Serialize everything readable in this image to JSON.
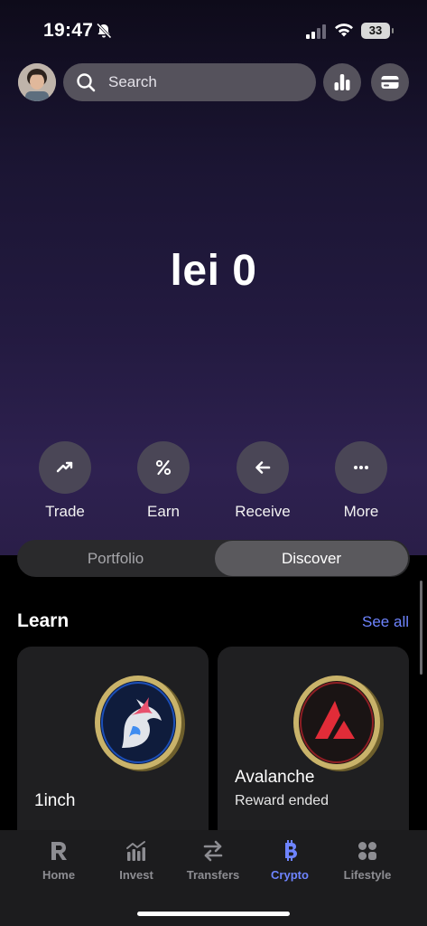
{
  "status_bar": {
    "time": "19:47",
    "battery": "33"
  },
  "header": {
    "search_placeholder": "Search"
  },
  "balance": "lei 0",
  "actions": [
    {
      "label": "Trade",
      "icon": "trend-up-icon"
    },
    {
      "label": "Earn",
      "icon": "percent-icon"
    },
    {
      "label": "Receive",
      "icon": "arrow-left-icon"
    },
    {
      "label": "More",
      "icon": "more-dots-icon"
    }
  ],
  "segments": {
    "portfolio": "Portfolio",
    "discover": "Discover",
    "selected": "Discover"
  },
  "learn": {
    "title": "Learn",
    "see_all": "See all",
    "cards": [
      {
        "name": "1inch",
        "subtitle": ""
      },
      {
        "name": "Avalanche",
        "subtitle": "Reward ended"
      }
    ]
  },
  "tabbar": [
    {
      "label": "Home",
      "icon": "revolut-r-icon"
    },
    {
      "label": "Invest",
      "icon": "chart-bars-icon"
    },
    {
      "label": "Transfers",
      "icon": "transfer-arrows-icon"
    },
    {
      "label": "Crypto",
      "icon": "bitcoin-icon",
      "active": true
    },
    {
      "label": "Lifestyle",
      "icon": "lifestyle-grid-icon"
    }
  ],
  "colors": {
    "accent": "#6e84ff",
    "hero_gradient_end": "#2e2150"
  }
}
